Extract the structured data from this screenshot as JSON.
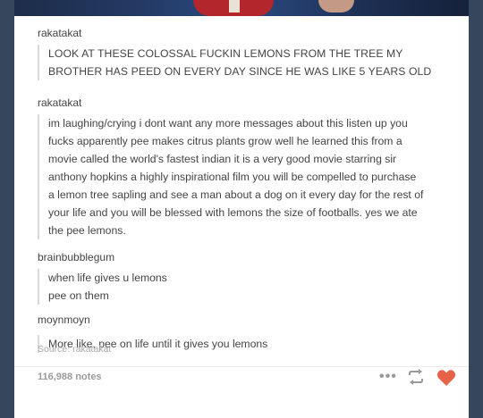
{
  "post": {
    "entries": [
      {
        "username": "rakatakat",
        "lines": [
          "LOOK AT THESE COLOSSAL FUCKIN LEMONS FROM THE TREE MY",
          "BROTHER HAS PEED ON EVERY DAY SINCE HE WAS LIKE 5 YEARS OLD"
        ]
      },
      {
        "username": "rakatakat",
        "lines": [
          "im laughing/crying i dont want any more messages about this listen up you",
          "fucks apparently pee makes citrus plants grow well he learned this from a",
          "movie called the world's fastest indian it is a very good movie starring sir",
          "anthony hopkins a highly inspirational film you will be compelled to purchase",
          "a lemon tree sapling and see a man about a dog on it every day for the rest of",
          "your life and you will be blessed with lemons the size of footballs. yes we ate",
          "the pee lemons."
        ]
      },
      {
        "username": "brainbubblegum",
        "lines": [
          "when life gives u lemons",
          "pee on them"
        ]
      },
      {
        "username": "moynmoyn",
        "lines": [
          "More like, pee on life until it gives you lemons"
        ]
      }
    ],
    "source": "Source: rakatakat",
    "notes": "116,988 notes",
    "icons": [
      "more-dots-icon",
      "reblog-icon",
      "heart-icon"
    ],
    "colors": {
      "heart": "#e8624a",
      "background": "#36465d"
    }
  }
}
